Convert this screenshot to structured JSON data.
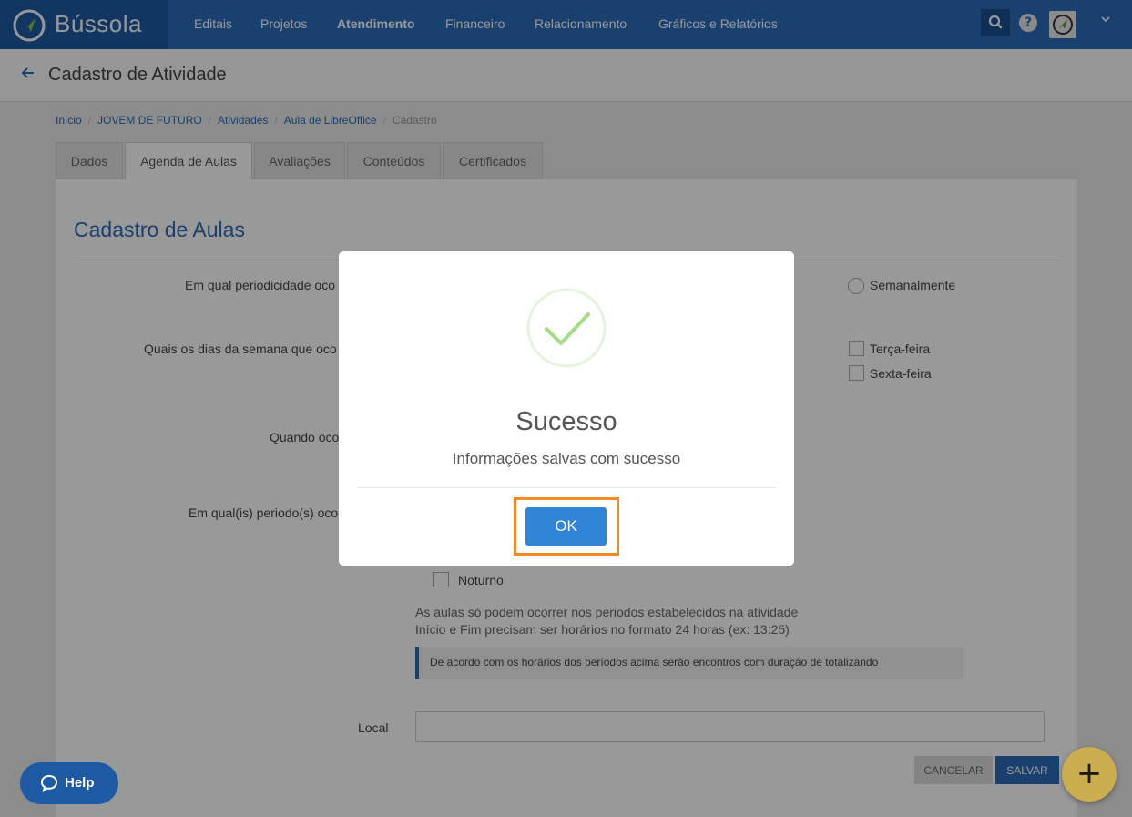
{
  "brand": {
    "name": "Bússola"
  },
  "nav": {
    "items": [
      {
        "label": "Editais",
        "active": false
      },
      {
        "label": "Projetos",
        "active": false
      },
      {
        "label": "Atendimento",
        "active": true
      },
      {
        "label": "Financeiro",
        "active": false
      },
      {
        "label": "Relacionamento",
        "active": false
      },
      {
        "label": "Gráficos e Relatórios",
        "active": false
      }
    ],
    "help_glyph": "?",
    "icons": [
      "search-icon",
      "help-icon",
      "compass-icon",
      "chevron-down-icon"
    ]
  },
  "page": {
    "title": "Cadastro de Atividade"
  },
  "breadcrumb": [
    {
      "label": "Início"
    },
    {
      "label": "JOVEM DE FUTURO"
    },
    {
      "label": "Atividades"
    },
    {
      "label": "Aula de LibreOffice"
    },
    {
      "label": "Cadastro"
    }
  ],
  "tabs": [
    {
      "label": "Dados"
    },
    {
      "label": "Agenda de Aulas"
    },
    {
      "label": "Avaliações"
    },
    {
      "label": "Conteúdos"
    },
    {
      "label": "Certificados"
    }
  ],
  "form": {
    "section_title": "Cadastro de Aulas",
    "q_periodicity": "Em qual periodicidade oco",
    "opt_weekly": "Semanalmente",
    "q_weekdays": "Quais os dias da semana que oco",
    "opt_tuesday": "Terça-feira",
    "opt_friday": "Sexta-feira",
    "q_when": "Quando oco",
    "q_periods": "Em qual(is) periodo(s) oco",
    "opt_night": "Noturno",
    "note_line1": "As aulas só podem ocorrer nos periodos estabelecidos na atividade",
    "note_line2": "Início e Fim precisam ser horários no formato 24 horas (ex: 13:25)",
    "info_text": "De acordo com os horários dos períodos acima serão encontros com duração de totalizando",
    "local_label": "Local",
    "local_value": "",
    "cancel_label": "CANCELAR",
    "save_label": "SALVAR"
  },
  "modal": {
    "title": "Sucesso",
    "message": "Informações salvas com sucesso",
    "ok_label": "OK",
    "success_color": "#a5dc86",
    "highlight_color": "#f08a24"
  },
  "help": {
    "label": "Help"
  },
  "fab": {
    "label": "+"
  },
  "colors": {
    "primary": "#2a6bb8",
    "brand_dark": "#1e5aa3",
    "ok_button": "#3085d6",
    "fab": "#c9ad4e"
  }
}
